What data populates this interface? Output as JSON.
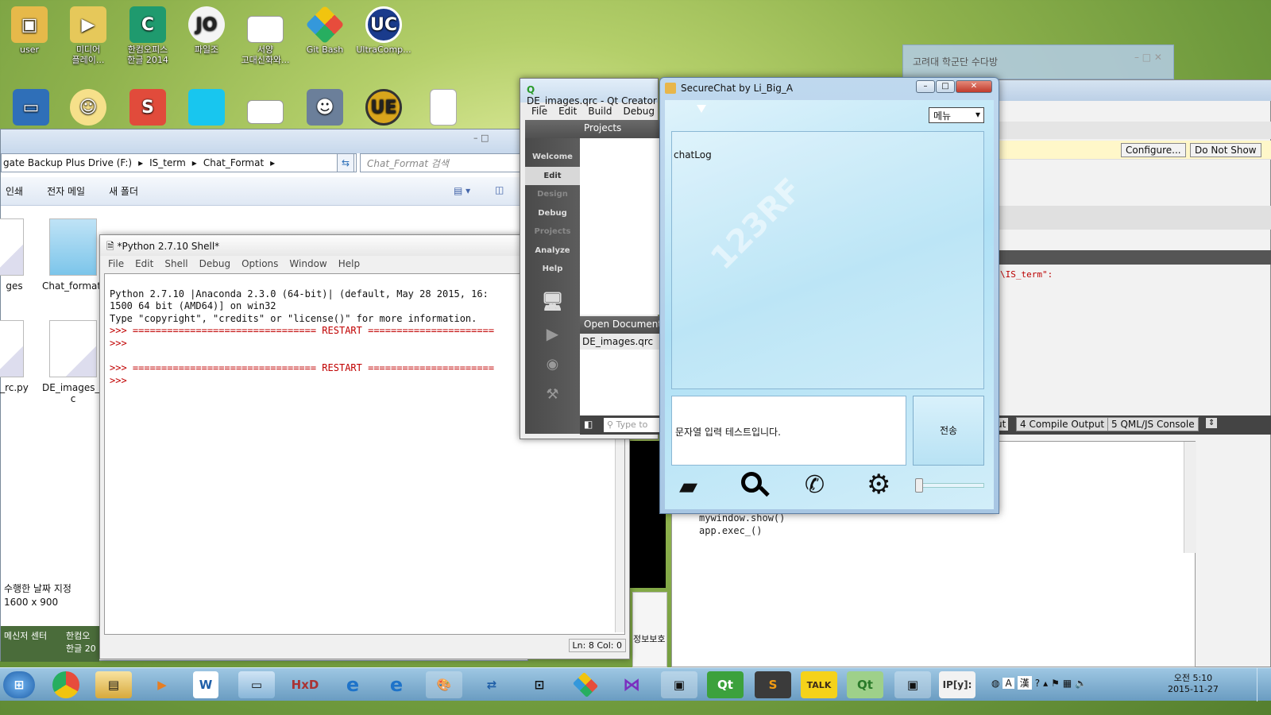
{
  "desktop": {
    "row1": [
      "user",
      "미디어\n플레이...",
      "한컴오피스\n한글 2014",
      "파일조",
      "서양\n고대신화와...",
      "Git Bash",
      "UltraComp..."
    ],
    "behind_window_title": "고려대 학군단 수다방"
  },
  "explorer": {
    "address_parts": [
      "gate Backup Plus Drive (F:)",
      "IS_term",
      "Chat_Format"
    ],
    "search_placeholder": "Chat_Format 검색",
    "commands": [
      "인쇄",
      "전자 메일",
      "새 폴더"
    ],
    "files": [
      "ges",
      "Chat_format.p",
      "_rc.py",
      "DE_images_rc.\nc"
    ],
    "details_label": "수행한 날짜 지정",
    "details_value": "1600 x 900",
    "partial_bottom": [
      "메신저 센터",
      "한컴오\n한글 20"
    ]
  },
  "python_shell": {
    "title": "*Python 2.7.10 Shell*",
    "menu": [
      "File",
      "Edit",
      "Shell",
      "Debug",
      "Options",
      "Window",
      "Help"
    ],
    "lines": [
      "Python 2.7.10 |Anaconda 2.3.0 (64-bit)| (default, May 28 2015, 16:",
      "1500 64 bit (AMD64)] on win32",
      "Type \"copyright\", \"credits\" or \"license()\" for more information.",
      ">>> ================================ RESTART ======================",
      ">>> ",
      "",
      ">>> ================================ RESTART ======================",
      ">>> "
    ],
    "status": "Ln: 8 Col: 0"
  },
  "qt_creator": {
    "title": "DE_images.qrc - Qt Creator",
    "menu": [
      "File",
      "Edit",
      "Build",
      "Debug"
    ],
    "modes": [
      "Welcome",
      "Edit",
      "Design",
      "Debug",
      "Projects",
      "Analyze",
      "Help"
    ],
    "projects_label": "Projects",
    "open_documents_label": "Open Documents",
    "open_documents": [
      "DE_images.qrc"
    ],
    "locator_placeholder": "Type to"
  },
  "qt_background": {
    "configure_button": "Configure...",
    "dont_show_button": "Do Not Show",
    "code_snippet": "\\IS_term\":",
    "code_lines": [
      "mywindow.show()",
      "app.exec_()"
    ],
    "bottom_tabs": [
      {
        "num": "4",
        "label": "Compile Output"
      },
      {
        "num": "5",
        "label": "QML/JS Console"
      }
    ],
    "partial_tab": "ut",
    "partial_label": "정보보호"
  },
  "securechat": {
    "title": "SecureChat by Li_Big_A",
    "menu_select": "메뉴",
    "chat_log_label": "chatLog",
    "input_text": "문자열 입력 테스트입니다.",
    "send_label": "전송",
    "watermark": "123RF",
    "toolbar": [
      "folder-icon",
      "search-icon",
      "phone-icon",
      "gear-icon"
    ],
    "volume": 0.0
  },
  "taskbar": {
    "time": "오전 5:10",
    "date": "2015-11-27",
    "ime": [
      "A",
      "漢"
    ]
  },
  "colors": {
    "taskbar": "#7fb0d4",
    "accent_red": "#c0392b",
    "prompt_red": "#c00000"
  }
}
